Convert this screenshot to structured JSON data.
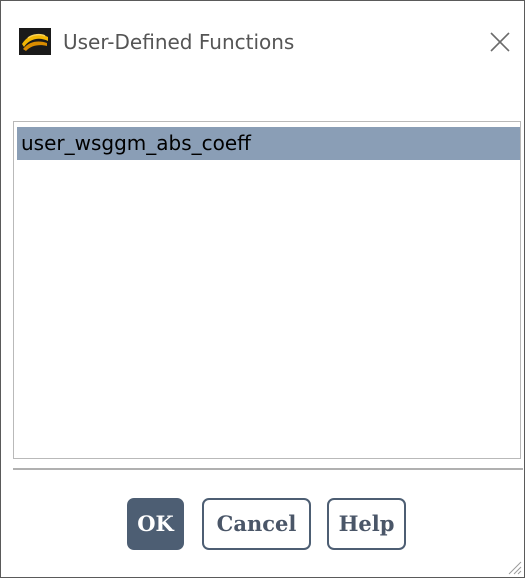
{
  "window": {
    "title": "User-Defined Functions",
    "icon": "ansys-fluent-app-icon",
    "close_icon": "close-icon"
  },
  "list": {
    "items": [
      {
        "label": "user_wsggm_abs_coeff",
        "selected": true
      }
    ],
    "selection_color": "#8a9eb6"
  },
  "buttons": {
    "ok_label": "OK",
    "cancel_label": "Cancel",
    "help_label": "Help",
    "primary_color": "#4d5e73"
  }
}
